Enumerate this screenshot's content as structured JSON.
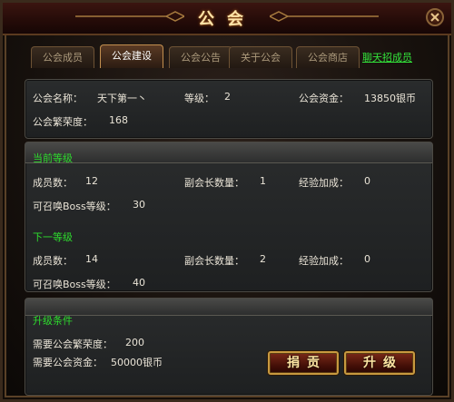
{
  "window": {
    "title": "公会"
  },
  "tabs": [
    {
      "label": "公会成员",
      "active": false
    },
    {
      "label": "公会建设",
      "active": true
    },
    {
      "label": "公会公告",
      "active": false
    },
    {
      "label": "关于公会",
      "active": false
    },
    {
      "label": "公会商店",
      "active": false
    }
  ],
  "recruit_link": "聊天招成员",
  "guild_info": {
    "name_label": "公会名称：",
    "name_value": "天下第一丶",
    "level_label": "等级：",
    "level_value": "2",
    "funds_label": "公会资金：",
    "funds_value": "13850银币",
    "prosperity_label": "公会繁荣度：",
    "prosperity_value": "168"
  },
  "current_level": {
    "heading": "当前等级",
    "members_label": "成员数：",
    "members_value": "12",
    "vice_label": "副会长数量：",
    "vice_value": "1",
    "exp_label": "经验加成：",
    "exp_value": "0",
    "boss_label": "可召唤Boss等级：",
    "boss_value": "30"
  },
  "next_level": {
    "heading": "下一等级",
    "members_label": "成员数：",
    "members_value": "14",
    "vice_label": "副会长数量：",
    "vice_value": "2",
    "exp_label": "经验加成：",
    "exp_value": "0",
    "boss_label": "可召唤Boss等级：",
    "boss_value": "40"
  },
  "upgrade": {
    "heading": "升级条件",
    "prosperity_label": "需要公会繁荣度：",
    "prosperity_value": "200",
    "funds_label": "需要公会资金：",
    "funds_value": "50000银币"
  },
  "buttons": {
    "donate": "捐贡",
    "upgrade": "升级"
  },
  "colors": {
    "accent_green": "#2edc2e",
    "title_gold": "#ffe4a8",
    "button_red": "#7a2918"
  }
}
